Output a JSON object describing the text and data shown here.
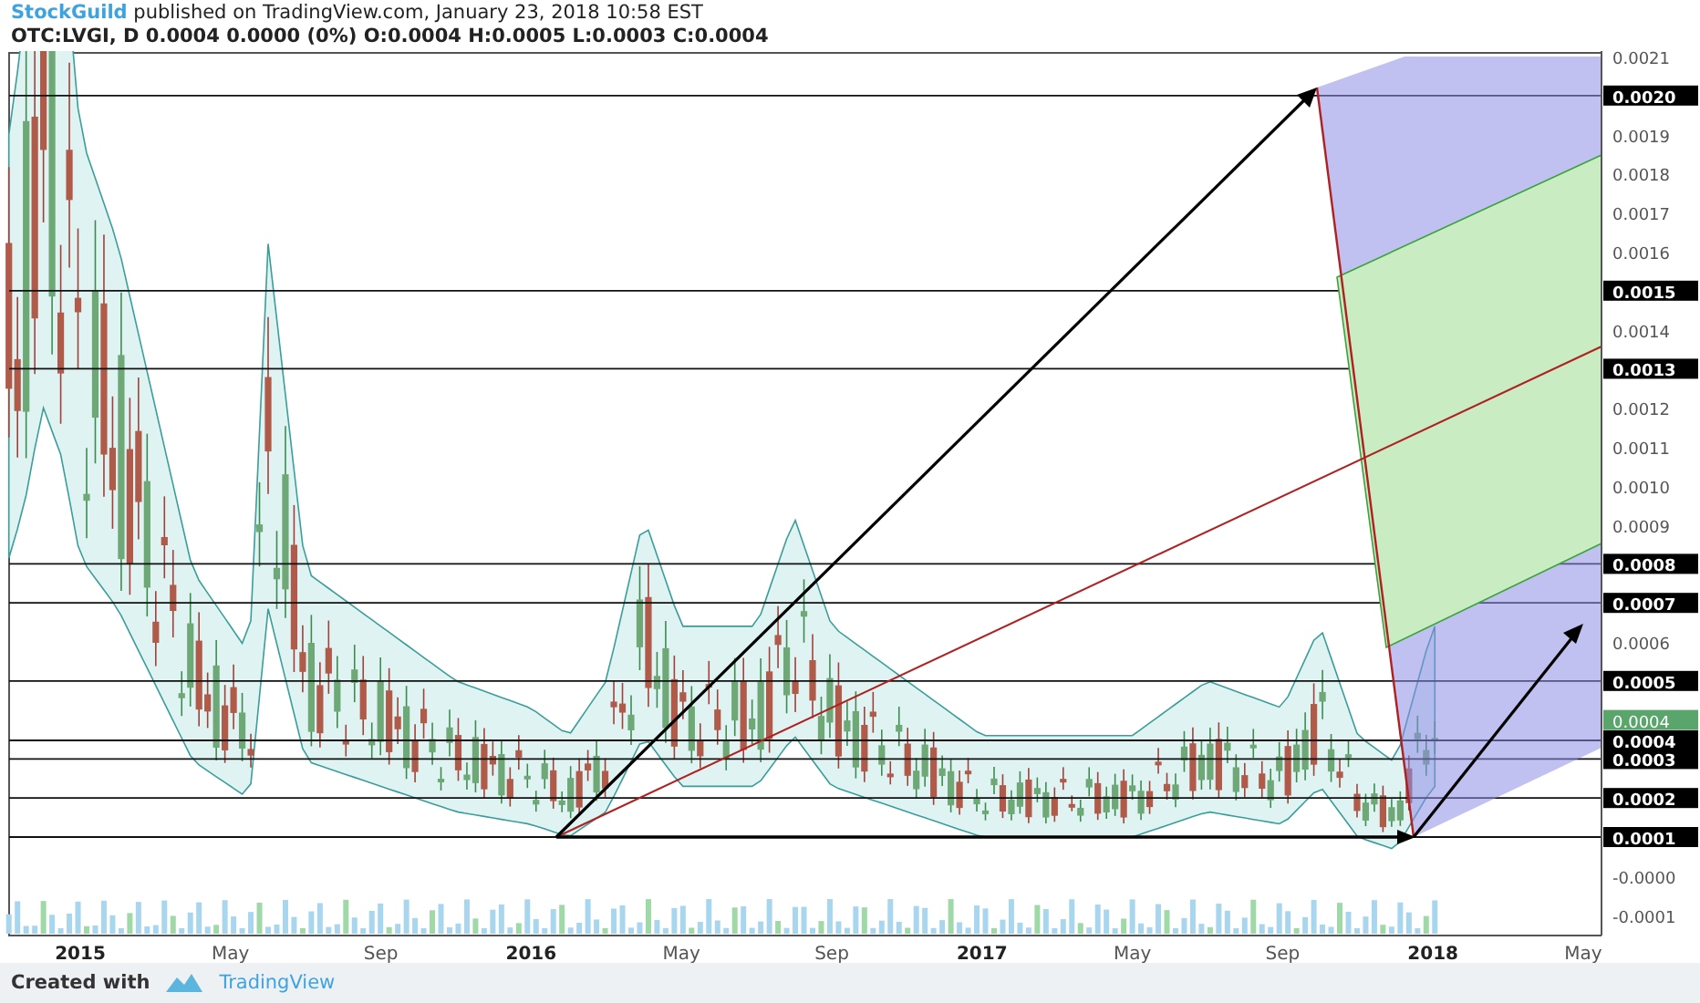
{
  "header": {
    "author": "StockGuild",
    "published": "published on TradingView.com, January 23, 2018 10:58 EST",
    "symbol_line": "OTC:LVGI, D  0.0004 0.0000 (0%) O:0.0004 H:0.0005 L:0.0003 C:0.0004"
  },
  "chart": {
    "price_axis": [
      {
        "label": "0.0021",
        "kind": "plain"
      },
      {
        "label": "0.0020",
        "kind": "tag"
      },
      {
        "label": "0.0019",
        "kind": "plain"
      },
      {
        "label": "0.0018",
        "kind": "plain"
      },
      {
        "label": "0.0017",
        "kind": "plain"
      },
      {
        "label": "0.0016",
        "kind": "plain"
      },
      {
        "label": "0.0015",
        "kind": "tag"
      },
      {
        "label": "0.0014",
        "kind": "plain"
      },
      {
        "label": "0.0013",
        "kind": "tag"
      },
      {
        "label": "0.0012",
        "kind": "plain"
      },
      {
        "label": "0.0011",
        "kind": "plain"
      },
      {
        "label": "0.0010",
        "kind": "plain"
      },
      {
        "label": "0.0009",
        "kind": "plain"
      },
      {
        "label": "0.0008",
        "kind": "tag"
      },
      {
        "label": "0.0007",
        "kind": "tag"
      },
      {
        "label": "0.0006",
        "kind": "plain"
      },
      {
        "label": "0.0005",
        "kind": "tag"
      },
      {
        "label": "0.0004",
        "kind": "current"
      },
      {
        "label": "0.0004",
        "kind": "tag"
      },
      {
        "label": "0.0003",
        "kind": "tag"
      },
      {
        "label": "0.0002",
        "kind": "tag"
      },
      {
        "label": "0.0001",
        "kind": "tag"
      },
      {
        "label": "-0.0000",
        "kind": "plain"
      },
      {
        "label": "-0.0001",
        "kind": "plain"
      }
    ],
    "time_axis": [
      {
        "label": "2015",
        "kind": "year"
      },
      {
        "label": "May",
        "kind": "month"
      },
      {
        "label": "Sep",
        "kind": "month"
      },
      {
        "label": "2016",
        "kind": "year"
      },
      {
        "label": "May",
        "kind": "month"
      },
      {
        "label": "Sep",
        "kind": "month"
      },
      {
        "label": "2017",
        "kind": "year"
      },
      {
        "label": "May",
        "kind": "month"
      },
      {
        "label": "Sep",
        "kind": "month"
      },
      {
        "label": "2018",
        "kind": "year"
      },
      {
        "label": "May",
        "kind": "month"
      }
    ]
  },
  "footer": {
    "created_with": "Created with",
    "brand": "TradingView"
  }
}
